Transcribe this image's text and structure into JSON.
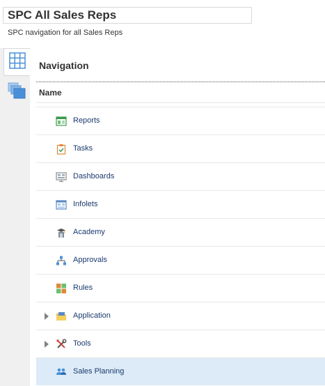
{
  "page": {
    "title": "SPC All Sales Reps",
    "subtitle": "SPC navigation for all Sales Reps"
  },
  "navigation": {
    "header": "Navigation",
    "column_header": "Name",
    "items": [
      {
        "label": "Reports",
        "icon": "reports-icon",
        "expandable": false,
        "selected": false
      },
      {
        "label": "Tasks",
        "icon": "tasks-icon",
        "expandable": false,
        "selected": false
      },
      {
        "label": "Dashboards",
        "icon": "dashboards-icon",
        "expandable": false,
        "selected": false
      },
      {
        "label": "Infolets",
        "icon": "infolets-icon",
        "expandable": false,
        "selected": false
      },
      {
        "label": "Academy",
        "icon": "academy-icon",
        "expandable": false,
        "selected": false
      },
      {
        "label": "Approvals",
        "icon": "approvals-icon",
        "expandable": false,
        "selected": false
      },
      {
        "label": "Rules",
        "icon": "rules-icon",
        "expandable": false,
        "selected": false
      },
      {
        "label": "Application",
        "icon": "application-icon",
        "expandable": true,
        "selected": false
      },
      {
        "label": "Tools",
        "icon": "tools-icon",
        "expandable": true,
        "selected": false
      },
      {
        "label": "Sales Planning",
        "icon": "sales-planning-icon",
        "expandable": false,
        "selected": true
      }
    ]
  },
  "side_tabs": [
    {
      "icon": "grid-icon",
      "active": true
    },
    {
      "icon": "cards-stack-icon",
      "active": false
    }
  ],
  "colors": {
    "link": "#1a3a6e",
    "selected_row": "#dcebf7",
    "side_panel": "#f0f0f0"
  }
}
